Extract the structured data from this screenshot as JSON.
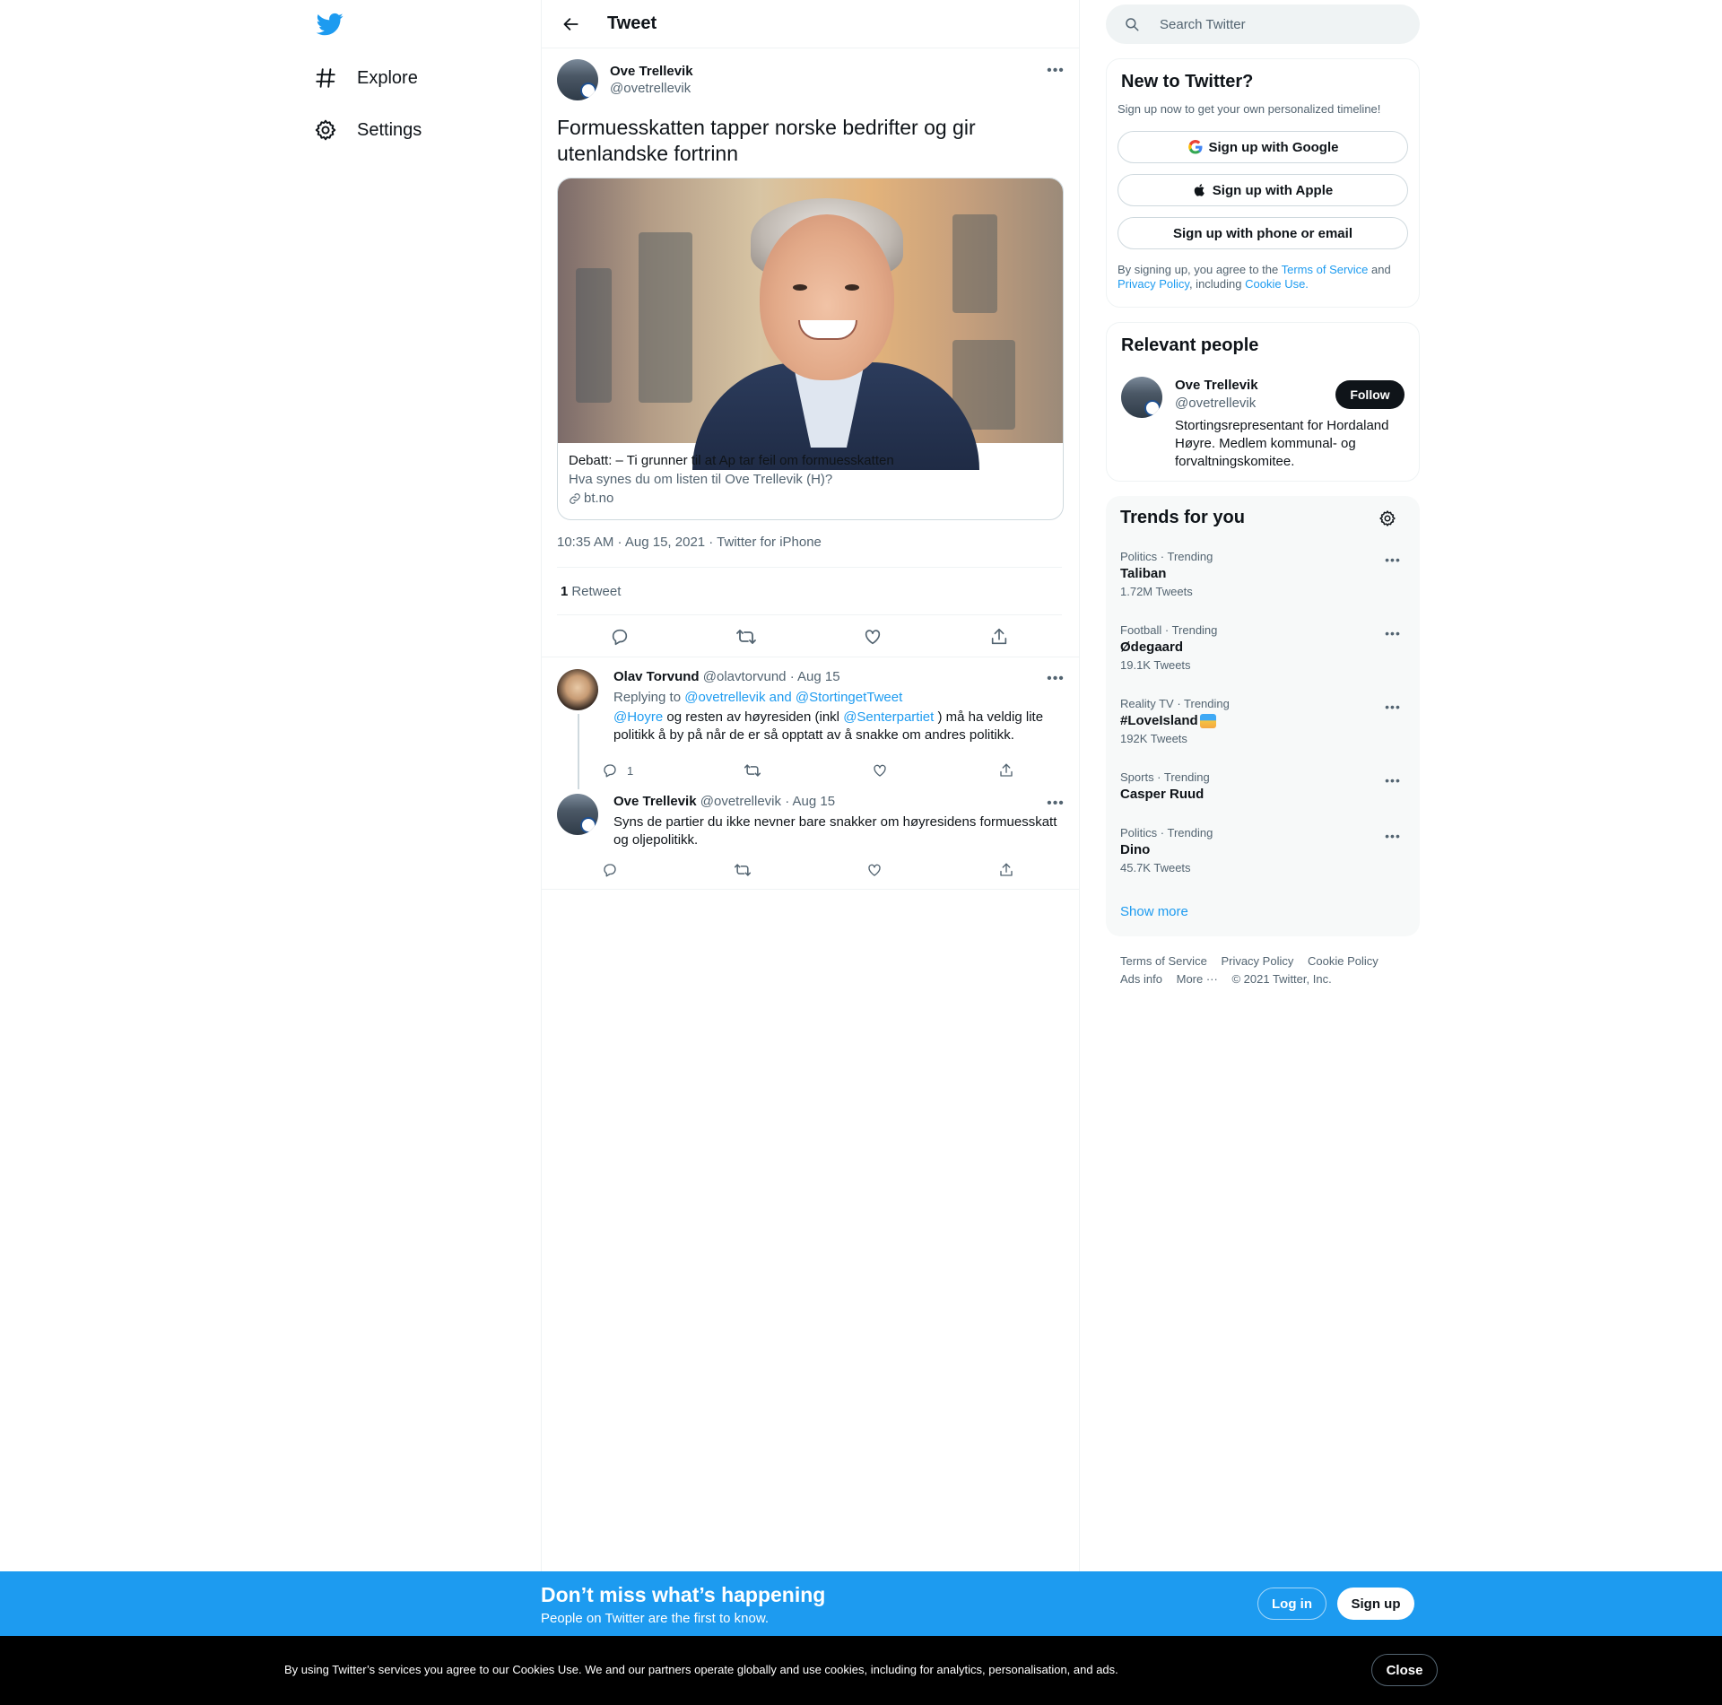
{
  "nav": {
    "explore_label": "Explore",
    "settings_label": "Settings",
    "logo_icon": "twitter-bird-icon",
    "brand_color": "#1d9bf0"
  },
  "main": {
    "header_title": "Tweet",
    "tweet": {
      "author_name": "Ove Trellevik",
      "author_handle": "@ovetrellevik",
      "text": "Formuesskatten tapper norske bedrifter og gir utenlandske fortrinn",
      "card": {
        "title": "Debatt: – Ti grunner til at Ap tar feil om formuesskatten",
        "description": "Hva synes du om listen til Ove Trellevik (H)?",
        "domain": "bt.no"
      },
      "timestamp": "10:35 AM · Aug 15, 2021 · Twitter for iPhone",
      "retweet_count": "1",
      "retweet_label": "Retweet"
    },
    "replies": [
      {
        "name": "Olav Torvund",
        "handle": "@olavtorvund",
        "date": "· Aug 15",
        "replying_prefix": "Replying to ",
        "replying_to": "@ovetrellevik and @StortingetTweet",
        "mention1": "@Hoyre",
        "text1": " og resten av høyresiden (inkl ",
        "mention2": "@Senterpartiet",
        "text2": " ) må ha veldig lite politikk å by på når de er så opptatt av å snakke om andres politikk.",
        "reply_count": "1"
      },
      {
        "name": "Ove Trellevik",
        "handle": "@ovetrellevik",
        "date": "· Aug 15",
        "text": "Syns de partier du ikke nevner bare snakker om høyresidens formuesskatt og oljepolitikk."
      }
    ]
  },
  "sidebar": {
    "search_placeholder": "Search Twitter",
    "new_to_twitter": {
      "title": "New to Twitter?",
      "subtitle": "Sign up now to get your own personalized timeline!",
      "google_label": "Sign up with Google",
      "apple_label": "Sign up with Apple",
      "phone_label": "Sign up with phone or email",
      "legal_1": "By signing up, you agree to the ",
      "tos_link": "Terms of Service",
      "legal_2": " and ",
      "privacy_link": "Privacy Policy",
      "legal_3": ", including ",
      "cookie_link": "Cookie Use."
    },
    "relevant_people": {
      "title": "Relevant people",
      "name": "Ove Trellevik",
      "handle": "@ovetrellevik",
      "bio": "Stortingsrepresentant for Hordaland Høyre. Medlem kommunal- og forvaltningskomitee.",
      "follow_label": "Follow"
    },
    "trends": {
      "title": "Trends for you",
      "items": [
        {
          "category": "Politics · Trending",
          "name": "Taliban",
          "count": "1.72M Tweets"
        },
        {
          "category": "Football · Trending",
          "name": "Ødegaard",
          "count": "19.1K Tweets"
        },
        {
          "category": "Reality TV · Trending",
          "name": "#LoveIsland",
          "count": "192K Tweets"
        },
        {
          "category": "Sports · Trending",
          "name": "Casper Ruud",
          "count": ""
        },
        {
          "category": "Politics · Trending",
          "name": "Dino",
          "count": "45.7K Tweets"
        }
      ],
      "show_more": "Show more"
    },
    "footer": {
      "tos": "Terms of Service",
      "privacy": "Privacy Policy",
      "cookie": "Cookie Policy",
      "ads": "Ads info",
      "more": "More ···",
      "copyright": "© 2021 Twitter, Inc."
    }
  },
  "signup_bar": {
    "title": "Don’t miss what’s happening",
    "subtitle": "People on Twitter are the first to know.",
    "login_label": "Log in",
    "signup_label": "Sign up"
  },
  "cookie_bar": {
    "message": "By using Twitter’s services you agree to our Cookies Use. We and our partners operate globally and use cookies, including for analytics, personalisation, and ads.",
    "close_label": "Close"
  }
}
